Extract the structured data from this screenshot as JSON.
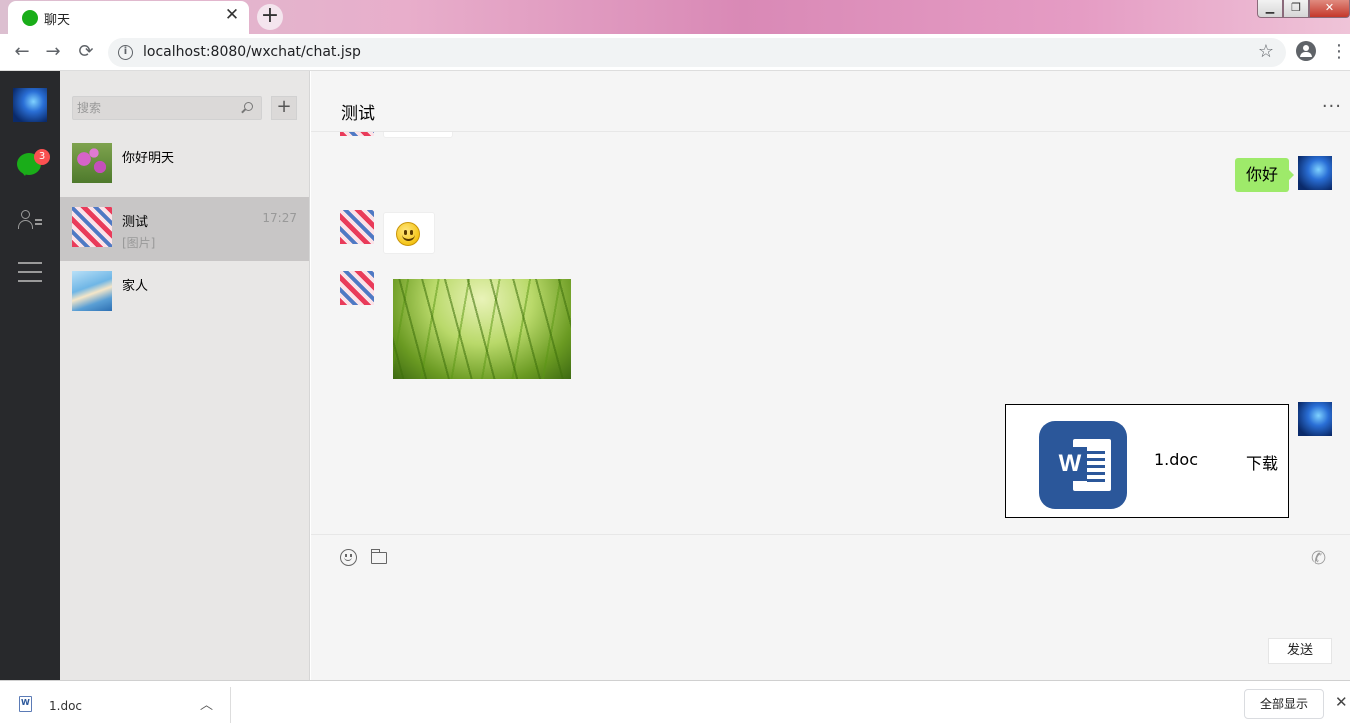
{
  "browser": {
    "tab_title": "聊天",
    "tab_close": "✕",
    "new_tab": "+",
    "url": "localhost:8080/wxchat/chat.jsp",
    "back": "←",
    "forward": "→",
    "reload": "⟳",
    "star": "☆",
    "menu": "⋮",
    "window_min": "▁",
    "window_max": "❐",
    "window_close": "✕"
  },
  "nav": {
    "chat_badge": "3"
  },
  "search": {
    "placeholder": "搜索"
  },
  "add_button_label": "+",
  "conversations": [
    {
      "name": "你好明天",
      "preview": "",
      "time": "",
      "active": false
    },
    {
      "name": "测试",
      "preview": "[图片]",
      "time": "17:27",
      "active": true
    },
    {
      "name": "家人",
      "preview": "",
      "time": "",
      "active": false
    }
  ],
  "chat": {
    "title": "测试",
    "more": "···",
    "messages": [
      {
        "from": "other",
        "type": "emoji"
      },
      {
        "from": "self",
        "type": "text",
        "text": "你好"
      },
      {
        "from": "other",
        "type": "emoji"
      },
      {
        "from": "other",
        "type": "image"
      },
      {
        "from": "self",
        "type": "file",
        "file_name": "1.doc",
        "download_label": "下载"
      }
    ]
  },
  "composer": {
    "phone": "✆",
    "send_label": "发送"
  },
  "downloads": {
    "file_name": "1.doc",
    "chevron": "︿",
    "show_all_label": "全部显示",
    "close": "✕"
  },
  "colors": {
    "wechat_green": "#1aad19",
    "bubble_green": "#9eea6a",
    "nav_bg": "#28292c",
    "list_bg": "#e8e7e6",
    "active_row": "#c8c6c6",
    "badge_red": "#fa5151",
    "word_blue": "#2b579a"
  }
}
